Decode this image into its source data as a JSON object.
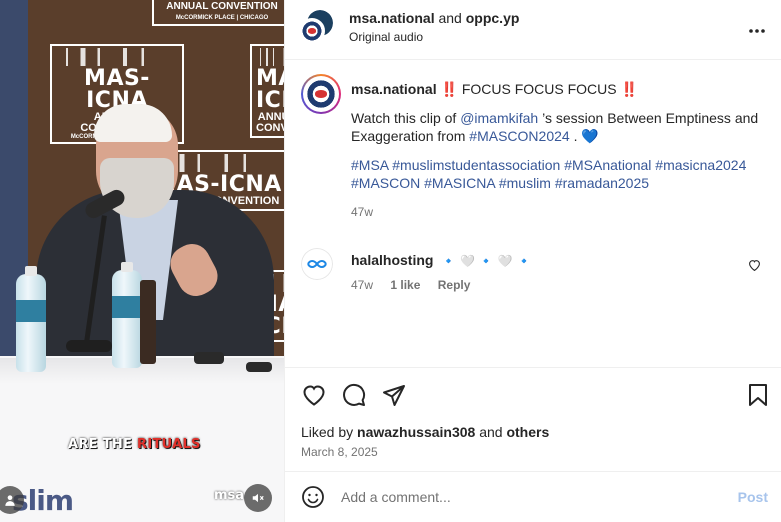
{
  "video": {
    "backdrop_title": "MAS-ICNA",
    "backdrop_subtitle": "ANNUAL CONVENTION",
    "backdrop_venue": "McCORMICK PLACE | CHICAGO",
    "caption_white": "ARE THE ",
    "caption_red": "RITUALS",
    "corner_text": "slim",
    "watermark": "msa",
    "mute_icon": "speaker-muted-icon"
  },
  "header": {
    "author": "msa.national",
    "joiner": " and ",
    "collaborator": "oppc.yp",
    "audio": "Original audio",
    "more_icon": "more-horizontal-icon"
  },
  "post_caption": {
    "username": "msa.national",
    "headline": "FOCUS FOCUS FOCUS",
    "bang": "‼️",
    "line_prefix": "Watch this clip of ",
    "mention": "@imamkifah",
    "line_mid": " ’s session Between Emptiness and Exaggeration from ",
    "hashtag_event": "#MASCON2024",
    "line_end": " . ",
    "heart": "💙",
    "hashtags": [
      "#MSA",
      "#muslimstudentassociation",
      "#MSAnational",
      "#masicna2024",
      "#MASCON",
      "#MASICNA",
      "#muslim",
      "#ramadan2025"
    ],
    "age": "47w"
  },
  "comment": {
    "username": "halalhosting",
    "emojis": [
      "🔹",
      "🤍",
      "🔹",
      "🤍",
      "🔹"
    ],
    "age": "47w",
    "likes": "1 like",
    "reply": "Reply"
  },
  "actions": {
    "liked_prefix": "Liked by ",
    "liked_user": "nawazhussain308",
    "liked_mid": " and ",
    "liked_others": "others",
    "date": "March 8, 2025"
  },
  "add_comment": {
    "placeholder": "Add a comment...",
    "post_label": "Post"
  },
  "colors": {
    "link": "#385898",
    "accent_red": "#e0245e",
    "post_disabled": "#a7c4ec"
  }
}
